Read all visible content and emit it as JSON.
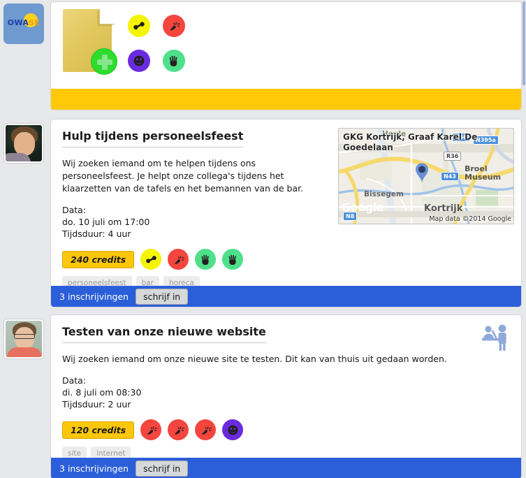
{
  "brand": {
    "name": "OWASE",
    "highlight": "SE",
    "sun_color": "#ffd21a",
    "tile_color": "#6f9ad0"
  },
  "theme": {
    "page_bg": "#e7e8ea",
    "accent_blue": "#2b5fd9",
    "accent_yellow": "#ffc907",
    "credits_yellow": "#fcc70b"
  },
  "new_card": {
    "name": "new-task-card",
    "document_icon": "document-icon",
    "add_icon": "plus-badge-icon",
    "category_icons": [
      {
        "name": "dumbbell-icon",
        "color": "#f5f500",
        "label": "fysiek"
      },
      {
        "name": "lightbulb-icon",
        "color": "#f5453f",
        "label": "creatief"
      },
      {
        "name": "smiley-icon",
        "color": "#6a2be0",
        "label": "sociaal"
      },
      {
        "name": "hand-icon",
        "color": "#4ee08a",
        "label": "helpen"
      }
    ]
  },
  "jobs": [
    {
      "id": "job-1",
      "avatar": "avatar-man-dark",
      "title": "Hulp tijdens personeelsfeest",
      "description": "Wij zoeken iemand om te helpen tijdens ons personeelsfeest. Je helpt onze collega's tijdens het klaarzetten van de tafels en het bemannen van de bar.",
      "date_label": "Data:",
      "date_value": "do. 10 juli om 17:00",
      "duration": "Tijdsduur: 4 uur",
      "credits": "240 credits",
      "icons": [
        {
          "name": "dumbbell-icon",
          "color": "#f5f500"
        },
        {
          "name": "lightbulb-icon",
          "color": "#f5453f"
        },
        {
          "name": "hand-icon",
          "color": "#4ee08a"
        },
        {
          "name": "hand-icon",
          "color": "#4ee08a"
        }
      ],
      "tags": [
        "personeelsfeest",
        "bar",
        "horeca"
      ],
      "subscriptions": "3 inschrijvingen",
      "action": "schrijf in",
      "header_icon": "two-people-icon",
      "map": {
        "title": "GKG Kortrijk, Graaf Karel De Goedelaan",
        "attribution": "Map data ©2014 Google",
        "watermark": "Google",
        "labels": [
          {
            "text": "Heule",
            "kind": "place"
          },
          {
            "text": "Bissegem",
            "kind": "place"
          },
          {
            "text": "Broel Museum",
            "kind": "poi"
          },
          {
            "text": "Kortrijk",
            "kind": "city"
          },
          {
            "text": "N43",
            "kind": "road-blue"
          },
          {
            "text": "N395a",
            "kind": "road-blue"
          },
          {
            "text": "N8",
            "kind": "road-blue"
          },
          {
            "text": "N50",
            "kind": "road-blue"
          },
          {
            "text": "R36",
            "kind": "road-white"
          }
        ],
        "marker": "map-pin"
      }
    },
    {
      "id": "job-2",
      "avatar": "avatar-man-glasses",
      "title": "Testen van onze nieuwe website",
      "description": "Wij zoeken iemand om onze nieuwe site te testen. Dit kan van thuis uit gedaan worden.",
      "date_label": "Data:",
      "date_value": "di. 8 juli om 08:30",
      "duration": "Tijdsduur: 2 uur",
      "credits": "120 credits",
      "icons": [
        {
          "name": "lightbulb-icon",
          "color": "#f5453f"
        },
        {
          "name": "lightbulb-icon",
          "color": "#f5453f"
        },
        {
          "name": "lightbulb-icon",
          "color": "#f5453f"
        },
        {
          "name": "smiley-icon",
          "color": "#6a2be0"
        }
      ],
      "tags": [
        "site",
        "internet"
      ],
      "subscriptions": "3 inschrijvingen",
      "action": "schrijf in",
      "header_icon": "reception-desk-icon"
    }
  ]
}
